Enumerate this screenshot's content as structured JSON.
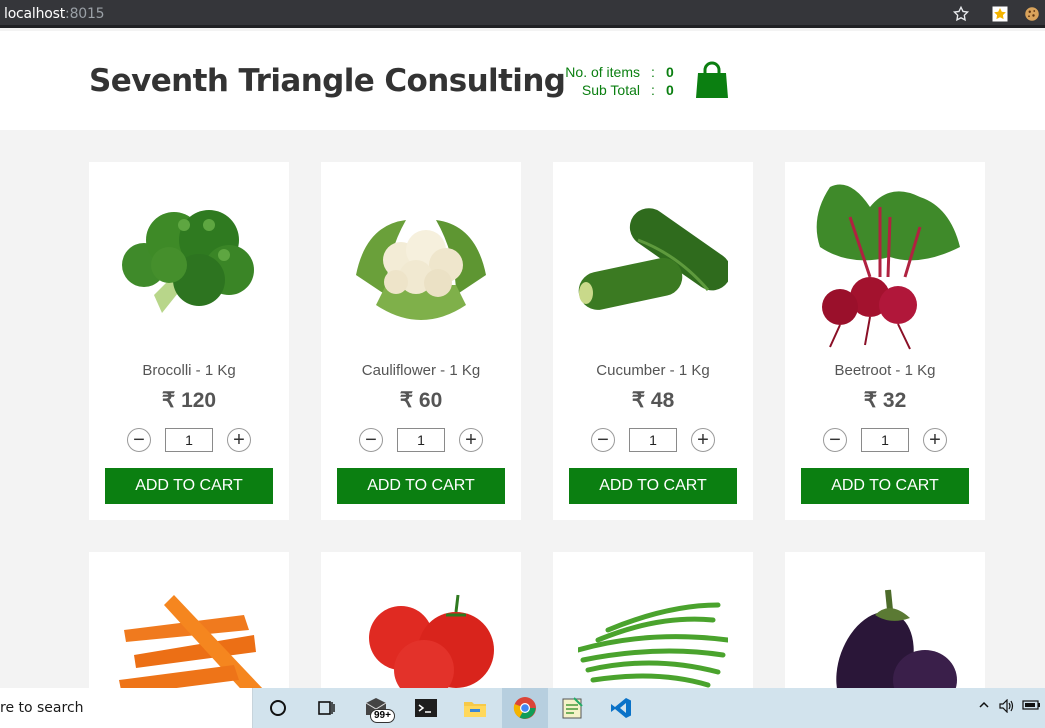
{
  "browser": {
    "host": "localhost",
    "port": ":8015",
    "icons": [
      "star-icon",
      "extension-star-icon",
      "cookie-icon"
    ]
  },
  "header": {
    "title": "Seventh Triangle Consulting",
    "items_label": "No. of items",
    "items_value": "0",
    "subtotal_label": "Sub Total",
    "subtotal_value": "0",
    "separator": ":",
    "cart_icon": "shopping-bag-icon"
  },
  "products": [
    {
      "name": "Brocolli - 1 Kg",
      "price": "₹ 120",
      "qty": "1",
      "button": "ADD TO CART",
      "image": "broccoli"
    },
    {
      "name": "Cauliflower - 1 Kg",
      "price": "₹ 60",
      "qty": "1",
      "button": "ADD TO CART",
      "image": "cauliflower"
    },
    {
      "name": "Cucumber - 1 Kg",
      "price": "₹ 48",
      "qty": "1",
      "button": "ADD TO CART",
      "image": "cucumber"
    },
    {
      "name": "Beetroot - 1 Kg",
      "price": "₹ 32",
      "qty": "1",
      "button": "ADD TO CART",
      "image": "beetroot"
    }
  ],
  "products_row2": [
    {
      "image": "carrot"
    },
    {
      "image": "tomato"
    },
    {
      "image": "beans"
    },
    {
      "image": "brinjal"
    }
  ],
  "stepper": {
    "minus": "−",
    "plus": "+"
  },
  "taskbar": {
    "search_text": "re to search",
    "badge": "99+",
    "icons": [
      "cortana-circle-icon",
      "task-view-icon",
      "mail-icon",
      "terminal-icon",
      "file-explorer-icon",
      "chrome-icon",
      "notepad-icon",
      "vscode-icon"
    ],
    "tray": [
      "chevron-up-icon",
      "speaker-icon",
      "battery-icon"
    ]
  },
  "colors": {
    "accent": "#0b7f11",
    "text": "#333333",
    "page_bg": "#f3f3f3"
  }
}
